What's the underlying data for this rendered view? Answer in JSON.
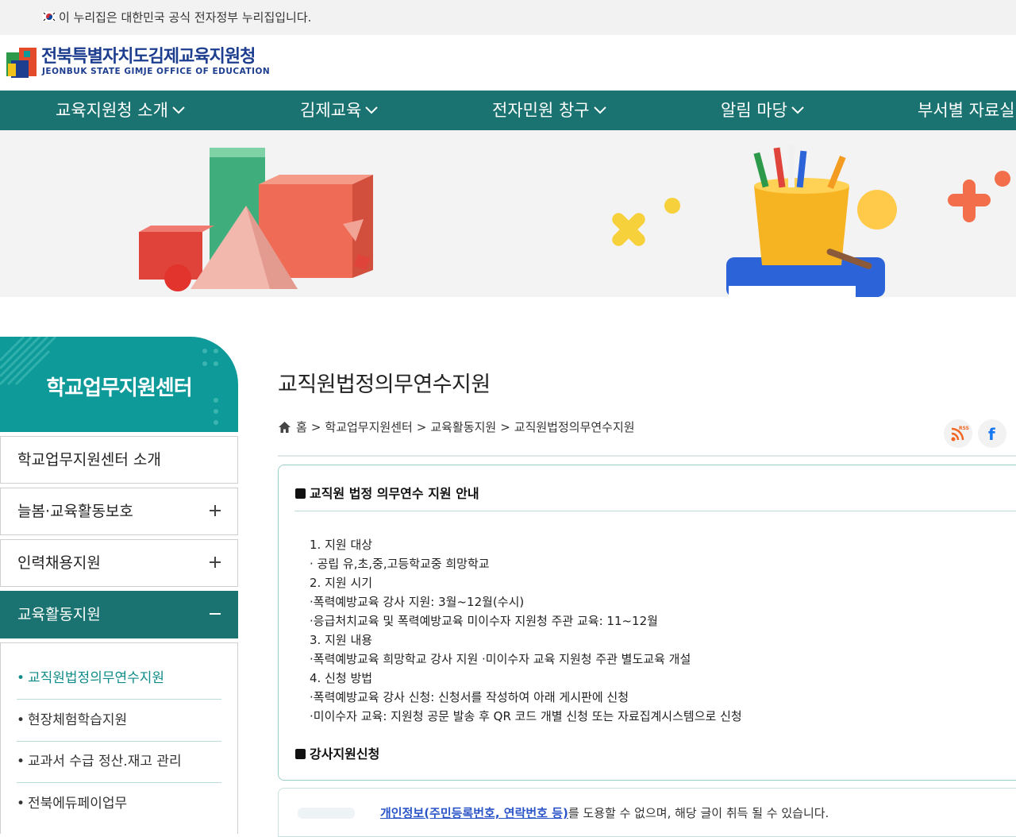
{
  "gov_bar": {
    "text": "이 누리집은 대한민국 공식 전자정부 누리집입니다.",
    "flag_icon": "korea-flag-icon"
  },
  "header": {
    "org_name": "전북특별자치도김제교육지원청",
    "org_name_eng": "JEONBUK STATE GIMJE OFFICE OF EDUCATION"
  },
  "gnb": [
    {
      "label": "교육지원청 소개"
    },
    {
      "label": "김제교육"
    },
    {
      "label": "전자민원 창구"
    },
    {
      "label": "알림 마당"
    },
    {
      "label": "부서별 자료실"
    }
  ],
  "sidebar": {
    "title": "학교업무지원센터",
    "menus": [
      {
        "label": "학교업무지원센터 소개",
        "expand": ""
      },
      {
        "label": "늘봄·교육활동보호",
        "expand": "plus"
      },
      {
        "label": "인력채용지원",
        "expand": "plus"
      },
      {
        "label": "교육활동지원",
        "expand": "minus"
      }
    ],
    "submenu": [
      {
        "label": "교직원법정의무연수지원",
        "active": true
      },
      {
        "label": "현장체험학습지원",
        "active": false
      },
      {
        "label": "교과서 수급 정산.재고 관리",
        "active": false
      },
      {
        "label": "전북에듀페이업무",
        "active": false
      }
    ]
  },
  "main": {
    "title": "교직원법정의무연수지원",
    "breadcrumb": {
      "home": "홈",
      "sep": ">",
      "level1": "학교업무지원센터",
      "level2": "교육활동지원",
      "level3": "교직원법정의무연수지원"
    },
    "social": {
      "rss_label": "RSS",
      "facebook_label": "f"
    },
    "box_title": "교직원 법정 의무연수 지원 안내",
    "items": [
      "1. 지원 대상",
      " · 공립 유,초,중,고등학교중 희망학교",
      "2. 지원 시기",
      " ·폭력예방교육 강사 지원: 3월~12월(수시)",
      " ·응급처치교육 및 폭력예방교육 미이수자 지원청 주관 교육: 11~12월",
      "3. 지원 내용",
      " ·폭력예방교육 희망학교 강사 지원  ·미이수자 교육 지원청 주관 별도교육 개설",
      "4. 신청 방법",
      " ·폭력예방교육 강사 신청: 신청서를 작성하여 아래 게시판에 신청",
      " ·미이수자 교육: 지원청 공문 발송 후 QR 코드 개별 신청 또는 자료집계시스템으로 신청"
    ],
    "box_title2": "강사지원신청",
    "warning_highlight": "개인정보(주민등록번호, 연락번호 등)",
    "warning_rest": "를 도용할 수 없으며, 해당 글이 취득 될 수 있습니다."
  },
  "colors": {
    "primary": "#1a7271",
    "accent": "#0d9a98",
    "brand_text": "#1d3d8f"
  }
}
